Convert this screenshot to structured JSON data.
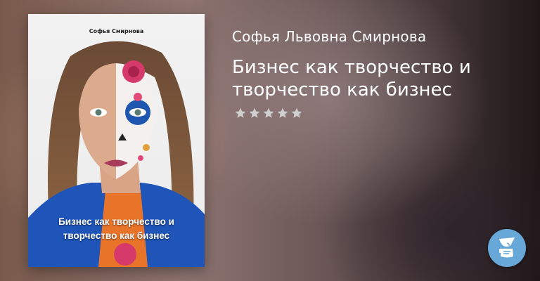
{
  "book": {
    "author": "Софья Львовна Смирнова",
    "title": "Бизнес как творчество и творчество как бизнес",
    "rating_stars": 5,
    "rating_filled": 0
  },
  "cover": {
    "author": "Софья Смирнова",
    "title": "Бизнес как творчество и\nтворчество как бизнес",
    "alt": "book-cover"
  },
  "colors": {
    "star": "#cfcfcf",
    "fab": "#67a8d8",
    "text": "#ffffff"
  },
  "icons": {
    "star": "star-icon",
    "assistant": "reader-assistant-icon"
  }
}
